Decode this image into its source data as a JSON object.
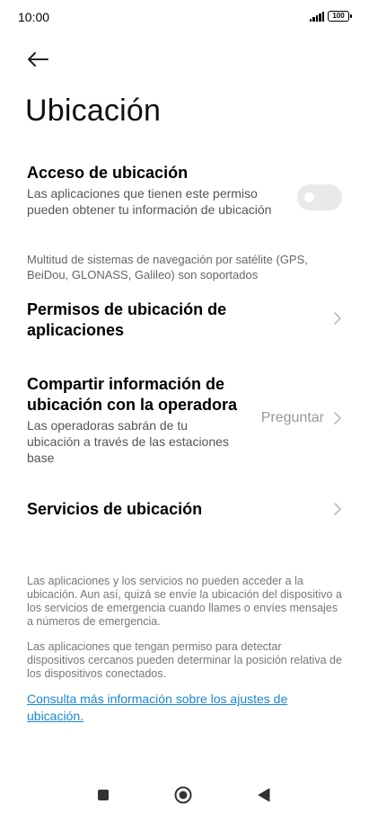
{
  "status_bar": {
    "time": "10:00",
    "battery": "100"
  },
  "header": {
    "back_icon": "arrow-left-icon",
    "title": "Ubicación"
  },
  "location_access": {
    "title": "Acceso de ubicación",
    "description": "Las aplicaciones que tienen este permiso pueden obtener tu información de ubicación",
    "enabled": false
  },
  "gnss_note": "Multitud de sistemas de navegación por satélite (GPS, BeiDou, GLONASS, Galileo) son soportados",
  "app_permissions": {
    "title": "Permisos de ubicación de aplicaciones"
  },
  "carrier_sharing": {
    "title": "Compartir información de ubicación con la operadora",
    "description": "Las operadoras sabrán de tu ubicación a través de las estaciones base",
    "value": "Preguntar"
  },
  "location_services": {
    "title": "Servicios de ubicación"
  },
  "footer": {
    "paragraph1": "Las aplicaciones y los servicios no pueden acceder a la ubicación. Aun así, quizá se envíe la ubicación del dispositivo a los servicios de emergencia cuando llames o envíes mensajes a números de emergencia.",
    "paragraph2": "Las aplicaciones que tengan permiso para detectar dispositivos cercanos pueden determinar la posición relativa de los dispositivos conectados.",
    "link": "Consulta más información sobre los ajustes de ubicación."
  },
  "nav_bar": {
    "recents_icon": "square-icon",
    "home_icon": "circle-icon",
    "back_icon": "triangle-back-icon"
  },
  "colors": {
    "link": "#1a86d6",
    "toggle_off": "#e9e9e9"
  }
}
